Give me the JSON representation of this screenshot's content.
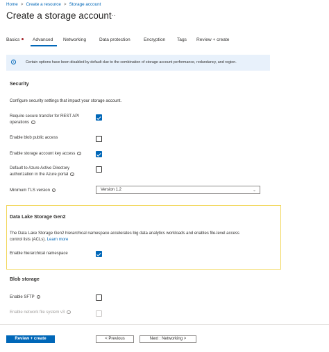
{
  "breadcrumb": [
    "Home",
    "Create a resource",
    "Storage account"
  ],
  "page_title": "Create a storage account",
  "more_label": "···",
  "tabs": [
    "Basics",
    "Advanced",
    "Networking",
    "Data protection",
    "Encryption",
    "Tags",
    "Review + create"
  ],
  "info_banner": "Certain options have been disabled by default due to the combination of storage account performance, redundancy, and region.",
  "security": {
    "heading": "Security",
    "description": "Configure security settings that impact your storage account.",
    "secure_transfer": {
      "label_line1": "Require secure transfer for REST API",
      "label_line2": "operations",
      "checked": true
    },
    "blob_public_access": {
      "label": "Enable blob public access",
      "checked": false
    },
    "account_key_access": {
      "label": "Enable storage account key access",
      "checked": true
    },
    "default_aad": {
      "label_line1": "Default to Azure Active Directory",
      "label_line2": "authorization in the Azure portal",
      "checked": false
    },
    "tls": {
      "label": "Minimum TLS version",
      "value": "Version 1.2"
    }
  },
  "data_lake": {
    "heading": "Data Lake Storage Gen2",
    "description_line1": "The Data Lake Storage Gen2 hierarchical namespace accelerates big data analytics workloads and enables file-level access",
    "description_line2": "control lists (ACLs).",
    "learn_more": "Learn more",
    "hierarchical_namespace": {
      "label": "Enable hierarchical namespace",
      "checked": true
    }
  },
  "blob_storage": {
    "heading": "Blob storage",
    "sftp": {
      "label": "Enable SFTP",
      "checked": false
    },
    "nfs": {
      "label": "Enable network file system v3",
      "checked": false,
      "disabled": true
    }
  },
  "footer": {
    "review_create": "Review + create",
    "previous": "< Previous",
    "next": "Next : Networking >"
  },
  "colors": {
    "accent": "#0067b8",
    "highlight_border": "#f2d75b",
    "info_bg": "#e8f1fb"
  }
}
